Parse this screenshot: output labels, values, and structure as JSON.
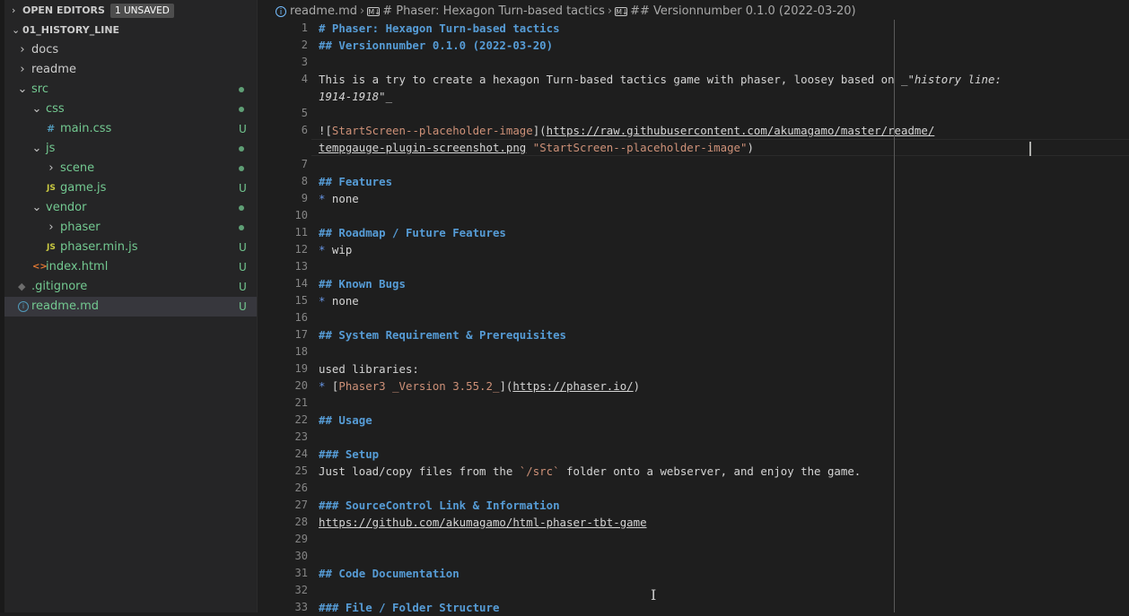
{
  "explorer": {
    "open_editors_label": "OPEN EDITORS",
    "unsaved_badge": "1 UNSAVED",
    "folder_label": "01_HISTORY_LINE"
  },
  "tree": [
    {
      "label": "docs",
      "type": "folder",
      "open": false,
      "depth": 1
    },
    {
      "label": "readme",
      "type": "folder",
      "open": false,
      "depth": 1
    },
    {
      "label": "src",
      "type": "folder",
      "open": true,
      "depth": 1,
      "dot": true
    },
    {
      "label": "css",
      "type": "folder",
      "open": true,
      "depth": 2,
      "dot": true
    },
    {
      "label": "main.css",
      "type": "file",
      "icon": "#",
      "depth": 3,
      "status": "U"
    },
    {
      "label": "js",
      "type": "folder",
      "open": true,
      "depth": 2,
      "dot": true
    },
    {
      "label": "scene",
      "type": "folder",
      "open": false,
      "depth": 3,
      "dot": true
    },
    {
      "label": "game.js",
      "type": "file",
      "icon": "JS",
      "depth": 3,
      "status": "U"
    },
    {
      "label": "vendor",
      "type": "folder",
      "open": true,
      "depth": 2,
      "dot": true
    },
    {
      "label": "phaser",
      "type": "folder",
      "open": false,
      "depth": 3,
      "dot": true
    },
    {
      "label": "phaser.min.js",
      "type": "file",
      "icon": "JS",
      "depth": 3,
      "status": "U"
    },
    {
      "label": "index.html",
      "type": "file",
      "icon": "<>",
      "depth": 2,
      "status": "U"
    },
    {
      "label": ".gitignore",
      "type": "file",
      "icon": "◆",
      "depth": 1,
      "status": "U"
    },
    {
      "label": "readme.md",
      "type": "file",
      "icon": "i",
      "depth": 1,
      "status": "U",
      "selected": true
    }
  ],
  "breadcrumb": {
    "file": "readme.md",
    "h1": "# Phaser: Hexagon Turn-based tactics",
    "h2": "## Versionnumber 0.1.0 (2022-03-20)"
  },
  "colors": {
    "tracked_file": "#73c991",
    "folder": "#cccccc",
    "selected_file": "#73c991",
    "heading": "#569cd6",
    "link_text": "#ce9178"
  },
  "line_numbers": [
    "1",
    "2",
    "3",
    "4",
    "",
    "5",
    "6",
    "",
    "7",
    "8",
    "9",
    "10",
    "11",
    "12",
    "13",
    "14",
    "15",
    "16",
    "17",
    "18",
    "19",
    "20",
    "21",
    "22",
    "23",
    "24",
    "25",
    "26",
    "27",
    "28",
    "29",
    "30",
    "31",
    "32",
    "33"
  ],
  "code_lines": [
    [
      {
        "t": "# Phaser: Hexagon Turn-based tactics",
        "c": "h"
      }
    ],
    [
      {
        "t": "## Versionnumber 0.1.0 (2022-03-20)",
        "c": "h"
      }
    ],
    [],
    [
      {
        "t": "This is a try to create a hexagon Turn-based tactics game with phaser, loosey based on _"
      },
      {
        "t": "\"history line:",
        "c": "em"
      }
    ],
    [
      {
        "t": "1914-1918\"",
        "c": "em"
      },
      {
        "t": "_"
      }
    ],
    [],
    [
      {
        "t": "!["
      },
      {
        "t": "StartScreen--placeholder-image",
        "c": "lt"
      },
      {
        "t": "]("
      },
      {
        "t": "https://raw.githubusercontent.com/akumagamo/master/readme/",
        "c": "lu"
      }
    ],
    [
      {
        "t": "tempgauge-plugin-screenshot.png",
        "c": "lu"
      },
      {
        "t": " "
      },
      {
        "t": "\"StartScreen--placeholder-image\"",
        "c": "lt"
      },
      {
        "t": ")"
      }
    ],
    [],
    [
      {
        "t": "## Features",
        "c": "h"
      }
    ],
    [
      {
        "t": "*",
        "c": "li"
      },
      {
        "t": " none"
      }
    ],
    [],
    [
      {
        "t": "## Roadmap / Future Features",
        "c": "h"
      }
    ],
    [
      {
        "t": "*",
        "c": "li"
      },
      {
        "t": " wip"
      }
    ],
    [],
    [
      {
        "t": "## Known Bugs",
        "c": "h"
      }
    ],
    [
      {
        "t": "*",
        "c": "li"
      },
      {
        "t": " none"
      }
    ],
    [],
    [
      {
        "t": "## System Requirement & Prerequisites",
        "c": "h"
      }
    ],
    [],
    [
      {
        "t": "used libraries:"
      }
    ],
    [
      {
        "t": "*",
        "c": "li"
      },
      {
        "t": " ["
      },
      {
        "t": "Phaser3 _Version 3.55.2_",
        "c": "lt"
      },
      {
        "t": "]("
      },
      {
        "t": "https://phaser.io/",
        "c": "lu"
      },
      {
        "t": ")"
      }
    ],
    [],
    [
      {
        "t": "## Usage",
        "c": "h"
      }
    ],
    [],
    [
      {
        "t": "### Setup",
        "c": "h"
      }
    ],
    [
      {
        "t": "Just load/copy files from the "
      },
      {
        "t": "`/src`",
        "c": "lt"
      },
      {
        "t": " folder onto a webserver, and enjoy the game."
      }
    ],
    [],
    [
      {
        "t": "### SourceControl Link & Information",
        "c": "h"
      }
    ],
    [
      {
        "t": "https://github.com/akumagamo/html-phaser-tbt-game",
        "c": "lu"
      }
    ],
    [],
    [],
    [
      {
        "t": "## Code Documentation",
        "c": "h"
      }
    ],
    [],
    [
      {
        "t": "### File / Folder Structure",
        "c": "h"
      }
    ]
  ]
}
